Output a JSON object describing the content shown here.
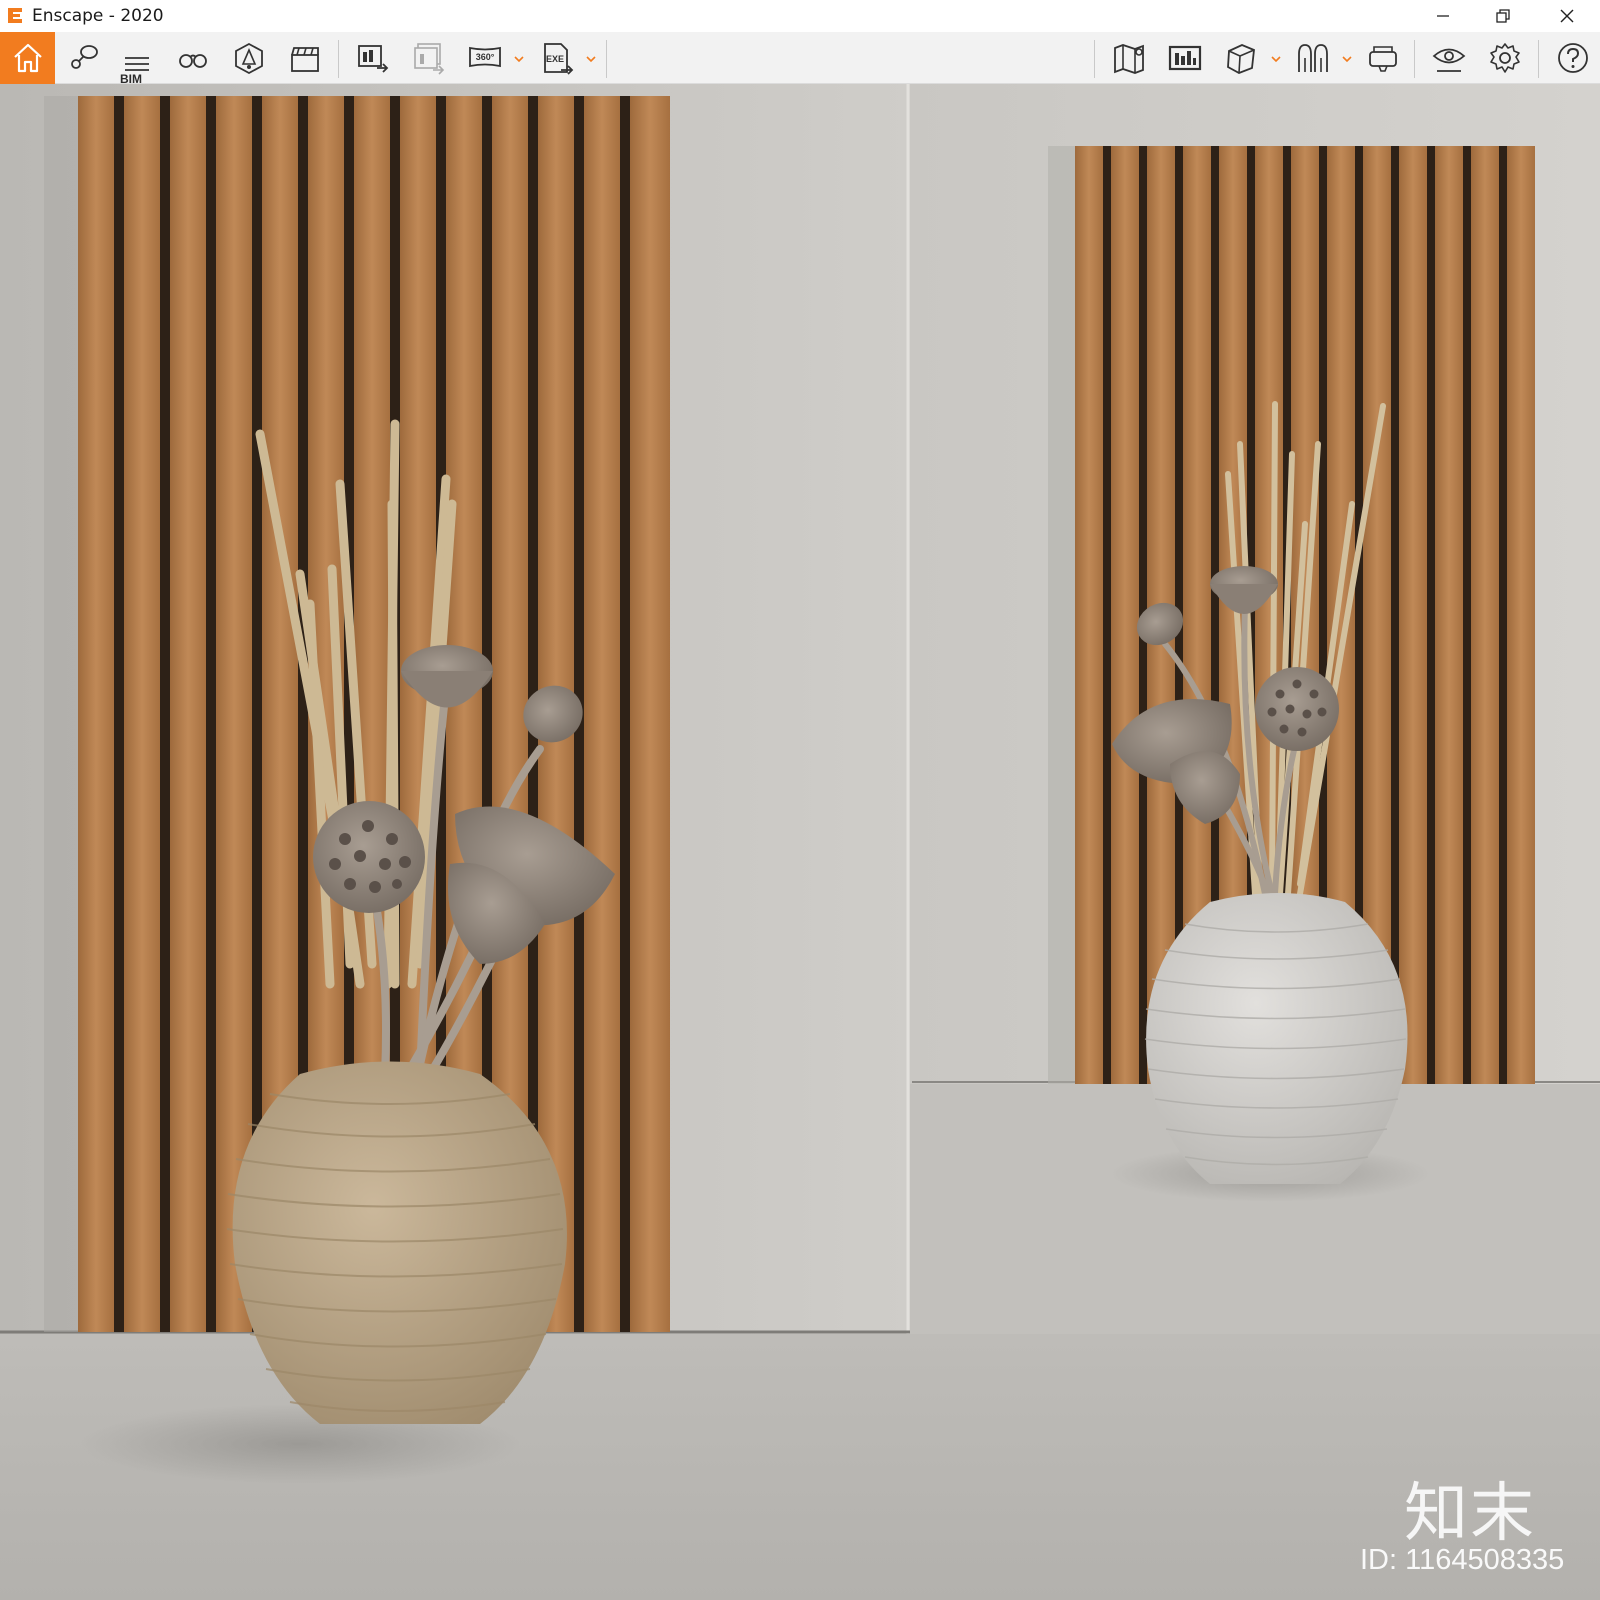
{
  "window": {
    "title": "Enscape - 2020",
    "controls": [
      "minimize",
      "restore",
      "close"
    ]
  },
  "toolbar": {
    "accent_color": "#f27c1f",
    "left_icons": [
      "home-icon",
      "views-icon",
      "bim-icon",
      "binoculars-icon",
      "settings-lights-icon",
      "video-clapper-icon",
      "screenshot-export-icon",
      "batch-export-icon",
      "panorama-360-icon",
      "exe-export-icon"
    ],
    "bim_label": "BIM",
    "panorama_label": "360°",
    "exe_label": "EXE",
    "right_icons": [
      "map-icon",
      "gallery-icon",
      "asset-cube-icon",
      "people-icon",
      "vr-headset-icon",
      "eye-icon",
      "gear-icon",
      "help-icon"
    ]
  },
  "scene": {
    "description_colors": {
      "wall": "#c8c6c2",
      "floor": "#bfbdb9",
      "wood": "#b07a47",
      "vase_left": "#bca88a",
      "vase_right": "#d6d4d1"
    }
  },
  "watermark": {
    "logo_text": "知末",
    "id_text": "ID: 1164508335"
  }
}
